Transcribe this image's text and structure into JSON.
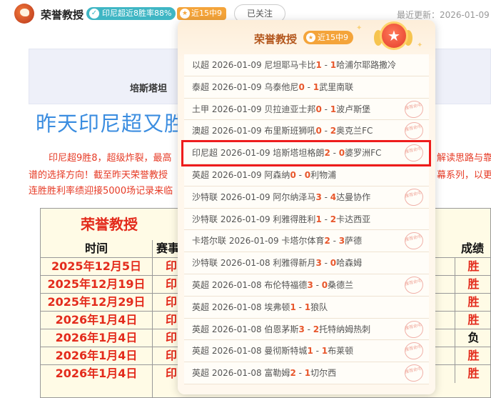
{
  "header": {
    "author": "荣誉教授",
    "badge_win_icon": "✓",
    "badge_win": "印尼超近8胜率88%",
    "badge_recent_icon": "★",
    "badge_recent": "近15中9",
    "follow": "已关注",
    "updated": "最近更新：2026-01-09"
  },
  "article": {
    "banner_text": "培斯塔坦",
    "title": "昨天印尼超又胜",
    "para_line1": "印尼超9胜8，超级炸裂，最高",
    "para_line1_right": "解读思路与靠",
    "para_line2": "谱的选择方向！截至昨天荣誉教授",
    "para_line2_right": "幕系列，以更高",
    "para_line3": "连胜胜利率绩迎接5000场记录来临"
  },
  "table": {
    "title": "荣誉教授",
    "headers": {
      "time": "时间",
      "event": "赛事",
      "result": "成绩"
    },
    "rows": [
      {
        "date": "2025年12月5日",
        "event": "印",
        "result": "胜"
      },
      {
        "date": "2025年12月19日",
        "event": "印",
        "result": "胜"
      },
      {
        "date": "2025年12月29日",
        "event": "印",
        "result": "胜"
      },
      {
        "date": "2026年1月4日",
        "event": "印",
        "result": "胜"
      },
      {
        "date": "2026年1月4日",
        "event": "印",
        "result": "负"
      },
      {
        "date": "2026年1月4日",
        "event": "印",
        "result": "胜"
      },
      {
        "date": "2026年1月4日",
        "event": "印",
        "result": "胜"
      }
    ],
    "colors": {
      "win": "#e32b1c",
      "loss": "#111111"
    }
  },
  "popup": {
    "title": "荣誉教授",
    "badge_icon": "★",
    "badge": "近15中9",
    "medal_icon": "★",
    "items": [
      {
        "league": "以超",
        "date": "2026-01-09",
        "home": "尼坦耶马卡比",
        "hs": "1",
        "as": "1",
        "away": "哈浦尔耶路撒冷",
        "hit": false
      },
      {
        "league": "泰超",
        "date": "2026-01-09",
        "home": "乌泰他尼",
        "hs": "0",
        "as": "1",
        "away": "武里南联",
        "hit": false
      },
      {
        "league": "土甲",
        "date": "2026-01-09",
        "home": "贝拉迪亚士邦",
        "hs": "0",
        "as": "1",
        "away": "波卢斯堡",
        "hit": true
      },
      {
        "league": "澳超",
        "date": "2026-01-09",
        "home": "布里斯班狮吼",
        "hs": "0",
        "as": "2",
        "away": "奥克兰FC",
        "hit": true
      },
      {
        "league": "印尼超",
        "date": "2026-01-09",
        "home": "培斯塔坦格朗",
        "hs": "2",
        "as": "0",
        "away": "婆罗洲FC",
        "hit": true
      },
      {
        "league": "英超",
        "date": "2026-01-09",
        "home": "阿森纳",
        "hs": "0",
        "as": "0",
        "away": "利物浦",
        "hit": false
      },
      {
        "league": "沙特联",
        "date": "2026-01-09",
        "home": "阿尔纳泽马",
        "hs": "3",
        "as": "4",
        "away": "达曼协作",
        "hit": true
      },
      {
        "league": "沙特联",
        "date": "2026-01-09",
        "home": "利雅得胜利",
        "hs": "1",
        "as": "2",
        "away": "卡达西亚",
        "hit": false
      },
      {
        "league": "卡塔尔联",
        "date": "2026-01-09",
        "home": "卡塔尔体育",
        "hs": "2",
        "as": "3",
        "away": "萨德",
        "hit": true
      },
      {
        "league": "沙特联",
        "date": "2026-01-08",
        "home": "利雅得新月",
        "hs": "3",
        "as": "0",
        "away": "哈森姆",
        "hit": false
      },
      {
        "league": "英超",
        "date": "2026-01-08",
        "home": "布伦特福德",
        "hs": "3",
        "as": "0",
        "away": "桑德兰",
        "hit": true
      },
      {
        "league": "英超",
        "date": "2026-01-08",
        "home": "埃弗顿",
        "hs": "1",
        "as": "1",
        "away": "狼队",
        "hit": false
      },
      {
        "league": "英超",
        "date": "2026-01-08",
        "home": "伯恩茅斯",
        "hs": "3",
        "as": "2",
        "away": "托特纳姆热刺",
        "hit": true
      },
      {
        "league": "英超",
        "date": "2026-01-08",
        "home": "曼彻斯特城",
        "hs": "1",
        "as": "1",
        "away": "布莱顿",
        "hit": true
      },
      {
        "league": "英超",
        "date": "2026-01-08",
        "home": "富勒姆",
        "hs": "2",
        "as": "1",
        "away": "切尔西",
        "hit": true
      }
    ],
    "stamp_text": "推荐命中"
  }
}
